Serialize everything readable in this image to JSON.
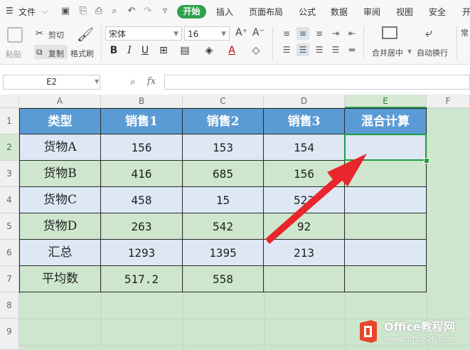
{
  "menu": {
    "file_label": "文件",
    "tabs": [
      "开始",
      "插入",
      "页面布局",
      "公式",
      "数据",
      "审阅",
      "视图",
      "安全",
      "开"
    ]
  },
  "toolbar": {
    "paste_label": "粘贴",
    "cut_label": "剪切",
    "copy_label": "复制",
    "format_painter_label": "格式刷",
    "font_name": "宋体",
    "font_size": "16",
    "merge_center_label": "合并居中",
    "wrap_text_label": "自动换行",
    "right_partial_label": "常"
  },
  "formula_bar": {
    "cell_ref": "E2",
    "fx_label": "fx",
    "formula": ""
  },
  "grid": {
    "columns": [
      "A",
      "B",
      "C",
      "D",
      "E",
      "F"
    ],
    "rows": [
      "1",
      "2",
      "3",
      "4",
      "5",
      "6",
      "7",
      "8",
      "9"
    ],
    "active_column": "E",
    "active_row": "2"
  },
  "table": {
    "headers": [
      "类型",
      "销售1",
      "销售2",
      "销售3",
      "混合计算"
    ],
    "rows": [
      [
        "货物A",
        "156",
        "153",
        "154",
        ""
      ],
      [
        "货物B",
        "416",
        "685",
        "156",
        ""
      ],
      [
        "货物C",
        "458",
        "15",
        "523",
        ""
      ],
      [
        "货物D",
        "263",
        "542",
        "92",
        ""
      ],
      [
        "汇总",
        "1293",
        "1395",
        "213",
        ""
      ],
      [
        "平均数",
        "517.2",
        "558",
        "",
        ""
      ]
    ]
  },
  "watermark": {
    "brand": "Office教程网",
    "url": "www.office26.com"
  },
  "colors": {
    "accent": "#2ea24a",
    "header_fill": "#5b9bd5",
    "light_row_fill": "#dde8f4",
    "sheet_green": "#cde6cd",
    "arrow": "#e8262b"
  }
}
